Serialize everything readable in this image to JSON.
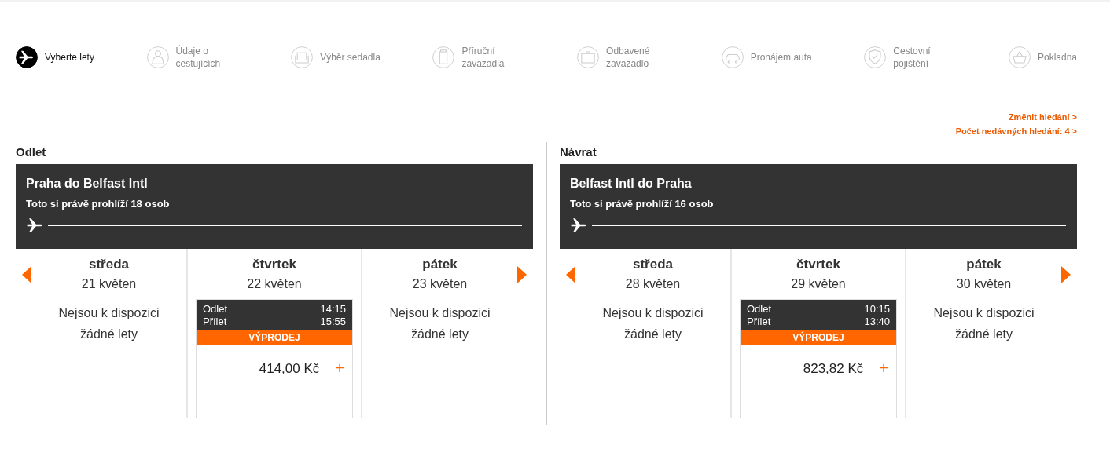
{
  "steps": [
    {
      "label": "Vyberte lety",
      "selected": true
    },
    {
      "label": "Údaje o cestujících",
      "selected": false
    },
    {
      "label": "Výběr sedadla",
      "selected": false
    },
    {
      "label": "Příruční zavazadla",
      "selected": false
    },
    {
      "label": "Odbavené zavazadlo",
      "selected": false
    },
    {
      "label": "Pronájem auta",
      "selected": false
    },
    {
      "label": "Cestovní pojištění",
      "selected": false
    },
    {
      "label": "Pokladna",
      "selected": false
    }
  ],
  "links": [
    "Změnit hledání >",
    "Počet nedávných hledání: 4 >"
  ],
  "journeys": [
    {
      "heading": "Odlet",
      "route": "Praha do Belfast Intl",
      "viewers": "Toto si právě prohlíží 18 osob",
      "days": [
        {
          "day": "středa",
          "date": "21 květen",
          "kind": "none",
          "message": "Nejsou k dispozici žádné lety"
        },
        {
          "day": "čtvrtek",
          "date": "22 květen",
          "kind": "flight",
          "depart_label": "Odlet",
          "depart_time": "14:15",
          "arrive_label": "Přílet",
          "arrive_time": "15:55",
          "badge": "VÝPRODEJ",
          "price": "414,00 Kč",
          "add": "+"
        },
        {
          "day": "pátek",
          "date": "23 květen",
          "kind": "none",
          "message": "Nejsou k dispozici žádné lety"
        }
      ]
    },
    {
      "heading": "Návrat",
      "route": "Belfast Intl do Praha",
      "viewers": "Toto si právě prohlíží 16 osob",
      "days": [
        {
          "day": "středa",
          "date": "28 květen",
          "kind": "none",
          "message": "Nejsou k dispozici žádné lety"
        },
        {
          "day": "čtvrtek",
          "date": "29 květen",
          "kind": "flight",
          "depart_label": "Odlet",
          "depart_time": "10:15",
          "arrive_label": "Přílet",
          "arrive_time": "13:40",
          "badge": "VÝPRODEJ",
          "price": "823,82 Kč",
          "add": "+"
        },
        {
          "day": "pátek",
          "date": "30 květen",
          "kind": "none",
          "message": "Nejsou k dispozici žádné lety"
        }
      ]
    }
  ]
}
